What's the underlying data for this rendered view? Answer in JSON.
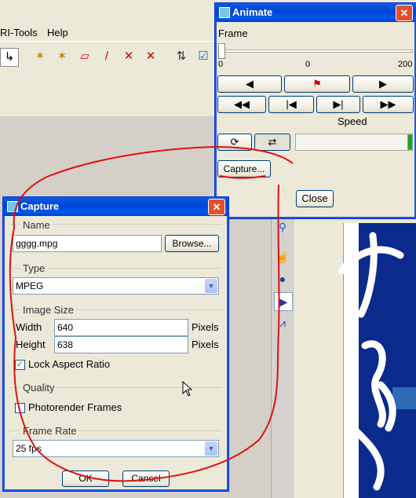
{
  "menubar": {
    "item1": "RI-Tools",
    "item2": "Help"
  },
  "animate": {
    "title": "Animate",
    "close_x": "✕",
    "frame_label": "Frame",
    "tick_min": "0",
    "tick_mid": "0",
    "tick_max": "200",
    "speed_label": "Speed",
    "capture_button": "Capture...",
    "close_button": "Close",
    "ctl_step_back": "◀",
    "ctl_flag": "⚑",
    "ctl_play": "▶",
    "ctl_rewind": "◀◀",
    "ctl_to_start": "|◀",
    "ctl_to_end": "▶|",
    "ctl_fast_forward": "▶▶",
    "loop_icon": "⟳",
    "bounce_icon": "⇄",
    "frame_position": 0,
    "speed_position": 1.0
  },
  "capture": {
    "title": "Capture",
    "close_x": "✕",
    "name_label": "Name",
    "name_value": "gggg.mpg",
    "browse_button": "Browse...",
    "type_label": "Type",
    "type_value": "MPEG",
    "image_size_label": "Image Size",
    "width_label": "Width",
    "width_value": "640",
    "width_unit": "Pixels",
    "height_label": "Height",
    "height_value": "638",
    "height_unit": "Pixels",
    "lock_aspect_label": "Lock Aspect Ratio",
    "lock_aspect_checked": true,
    "quality_label": "Quality",
    "photorender_label": "Photorender Frames",
    "photorender_checked": false,
    "frame_rate_label": "Frame Rate",
    "frame_rate_value": "25 fps",
    "ok_button": "OK",
    "cancel_button": "Cancel",
    "check_mark": "✓",
    "combo_arrow": "▼"
  },
  "colors": {
    "annotation_red": "#e01010",
    "title_blue": "#0a5fe8",
    "view_dark": "#0a2a8c"
  }
}
